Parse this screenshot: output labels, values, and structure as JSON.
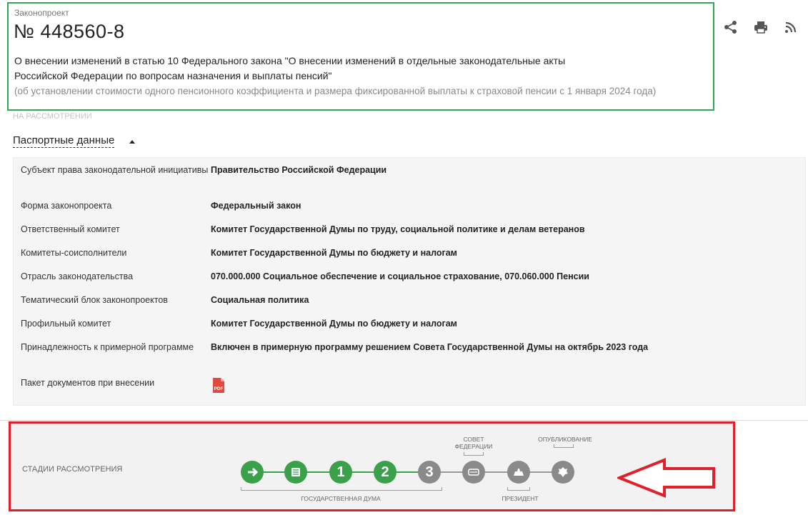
{
  "bill": {
    "type_label": "Законопроект",
    "number": "№ 448560-8",
    "title_line1": "О внесении изменений в статью 10 Федерального закона \"О внесении изменений в отдельные законодательные акты",
    "title_line2": "Российской Федерации по вопросам назначения и выплаты пенсий\"",
    "note": "(об установлении стоимости одного пенсионного коэффициента и размера фиксированной выплаты к страховой пенсии с 1 января 2024 года)",
    "status": "НА РАССМОТРЕНИИ"
  },
  "toolbar": {
    "icons": [
      "share-icon",
      "print-icon",
      "rss-icon"
    ]
  },
  "passport": {
    "toggle_label": "Паспортные данные",
    "rows": [
      {
        "key": "Субъект права законодательной инициативы",
        "value": "Правительство Российской Федерации"
      },
      {
        "key": "Форма законопроекта",
        "value": "Федеральный закон"
      },
      {
        "key": "Ответственный комитет",
        "value": "Комитет Государственной Думы по труду, социальной политике и делам ветеранов"
      },
      {
        "key": "Комитеты-соисполнители",
        "value": "Комитет Государственной Думы по бюджету и налогам"
      },
      {
        "key": "Отрасль законодательства",
        "value": "070.000.000 Социальное обеспечение и социальное страхование, 070.060.000 Пенсии"
      },
      {
        "key": "Тематический блок законопроектов",
        "value": "Социальная политика"
      },
      {
        "key": "Профильный комитет",
        "value": "Комитет Государственной Думы по бюджету и налогам"
      },
      {
        "key": "Принадлежность к примерной программе",
        "value": "Включен в примерную программу решением Совета Государственной Думы на октябрь 2023 года"
      },
      {
        "key": "Пакет документов при внесении",
        "value": ""
      }
    ],
    "pdf_label": "PDF"
  },
  "stages": {
    "label": "СТАДИИ РАССМОТРЕНИЯ",
    "duma_label": "ГОСУДАРСТВЕННАЯ ДУМА",
    "council_label_1": "СОВЕТ",
    "council_label_2": "ФЕДЕРАЦИИ",
    "president_label": "ПРЕЗИДЕНТ",
    "published_label": "ОПУБЛИКОВАНИЕ",
    "items": [
      {
        "name": "introduction",
        "text": "",
        "done": true
      },
      {
        "name": "preliminary",
        "text": "",
        "done": true
      },
      {
        "name": "reading-1",
        "text": "1",
        "done": true
      },
      {
        "name": "reading-2",
        "text": "2",
        "done": true
      },
      {
        "name": "reading-3",
        "text": "3",
        "done": false
      },
      {
        "name": "federation-council",
        "text": "",
        "done": false
      },
      {
        "name": "president",
        "text": "",
        "done": false
      },
      {
        "name": "publication",
        "text": "",
        "done": false
      }
    ],
    "colors": {
      "done": "#3aa14a",
      "pending": "#8a8a8a",
      "line_done": "#3aa14a",
      "line_pending": "#999999"
    }
  },
  "annotation": {
    "header_box_color": "#2fa84f",
    "stages_box_color": "#e0202a",
    "arrow_color": "#e0202a"
  }
}
